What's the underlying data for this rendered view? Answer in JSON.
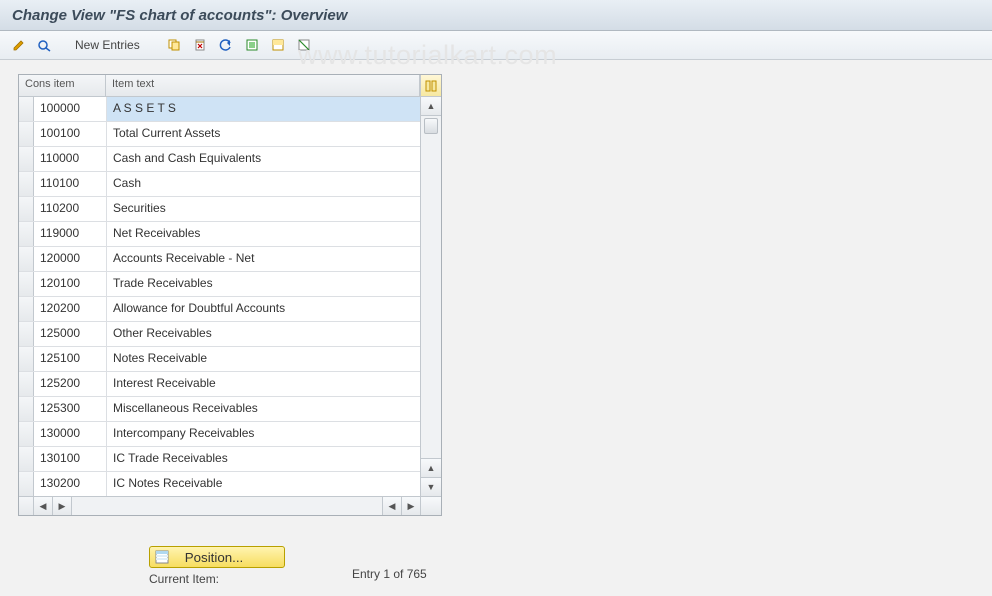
{
  "title": "Change View \"FS chart of accounts\": Overview",
  "toolbar": {
    "new_entries_label": "New Entries"
  },
  "watermark": "www.tutorialkart.com",
  "table": {
    "col_cons_header": "Cons item",
    "col_text_header": "Item text",
    "rows": [
      {
        "cons": "100000",
        "text": "A S S E T S",
        "selected": true
      },
      {
        "cons": "100100",
        "text": "Total Current Assets"
      },
      {
        "cons": "110000",
        "text": "Cash and Cash Equivalents"
      },
      {
        "cons": "110100",
        "text": "Cash"
      },
      {
        "cons": "110200",
        "text": "Securities"
      },
      {
        "cons": "119000",
        "text": "Net Receivables"
      },
      {
        "cons": "120000",
        "text": "Accounts Receivable - Net"
      },
      {
        "cons": "120100",
        "text": "Trade Receivables"
      },
      {
        "cons": "120200",
        "text": "Allowance for Doubtful Accounts"
      },
      {
        "cons": "125000",
        "text": "Other Receivables"
      },
      {
        "cons": "125100",
        "text": "Notes Receivable"
      },
      {
        "cons": "125200",
        "text": "Interest Receivable"
      },
      {
        "cons": "125300",
        "text": "Miscellaneous Receivables"
      },
      {
        "cons": "130000",
        "text": "Intercompany Receivables"
      },
      {
        "cons": "130100",
        "text": "IC Trade Receivables"
      },
      {
        "cons": "130200",
        "text": "IC Notes Receivable"
      }
    ]
  },
  "footer": {
    "position_label": "Position...",
    "current_item_label": "Current Item:",
    "entry_of": "Entry 1 of 765"
  }
}
